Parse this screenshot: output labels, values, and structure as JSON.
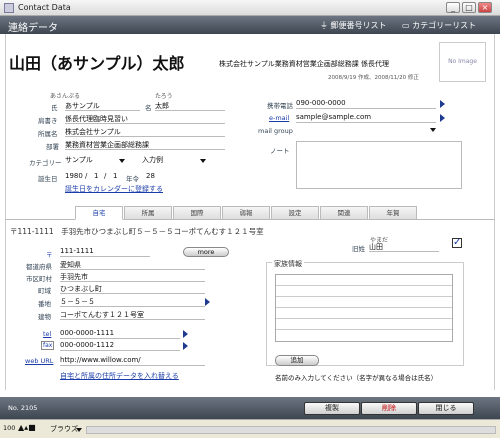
{
  "window": {
    "title": "Contact Data"
  },
  "header": {
    "title": "連絡データ",
    "link_postal": "郵便番号リスト",
    "link_category": "カテゴリーリスト"
  },
  "contact": {
    "name": "山田（あサンプル）太郎",
    "company_title": "株式会社サンプル業務資材営業企画部総務課 係長代理",
    "dates": "2008/9/19 作成、2008/11/20 修正",
    "no_image": "No Image",
    "kana_label": "ふりがな",
    "kana_sei": "あさんぷる",
    "kana_mei": "たろう",
    "sei_label": "氏",
    "sei": "あサンプル",
    "mei_label": "名",
    "mei": "太郎",
    "title_label": "肩書き",
    "title": "係長代理臨時見習い",
    "company_label": "所属名",
    "company": "株式会社サンプル",
    "dept_label": "部署",
    "dept": "業務資材営業企画部総務課",
    "category_label": "カテゴリー",
    "category": "サンプル",
    "category2": "入力例",
    "birthday_label": "誕生日",
    "birth_year": "1980",
    "birth_month": "1",
    "birth_day": "1",
    "age_label": "年令",
    "age": "28",
    "birthday_link": "誕生日をカレンダーに登録する"
  },
  "right": {
    "mobile_label": "携帯電話",
    "mobile": "090-000-0000",
    "email_label": "e-mail",
    "email": "sample@sample.com",
    "mailgroup_label": "mail group",
    "note_label": "ノート"
  },
  "tabs": [
    "自宅",
    "所属",
    "国際",
    "弱報",
    "設定",
    "関連",
    "年賀"
  ],
  "home": {
    "address_header": "〒111-1111　手羽先市ひつまぶし町５－５－５コーポてんむす１２１号室",
    "yashi_label": "やまだ",
    "kyusei_label": "旧姓",
    "kyusei": "山田",
    "postal_label": "〒",
    "postal": "111-1111",
    "more_label": "more",
    "pref_label": "都道府県",
    "pref": "愛知県",
    "city_label": "市区町村",
    "city": "手羽先市",
    "town_label": "町域",
    "town": "ひつまぶし町",
    "banchi_label": "番地",
    "banchi": "５－５－５",
    "building_label": "建物",
    "building": "コーポてんむす１２１号室",
    "tel_label": "tel",
    "tel": "000-0000-1111",
    "fax_label": "fax",
    "fax": "000-0000-1112",
    "web_label": "web URL",
    "web": "http://www.willow.com/",
    "swap_link": "自宅と所属の住所データを入れ替える",
    "family_title": "家族情報",
    "add_label": "追加",
    "family_note": "名前のみ入力してください（名字が異なる場合は氏名）"
  },
  "footer": {
    "record_no": "No. 2105",
    "dup": "複製",
    "delete": "削除",
    "close": "閉じる"
  },
  "status": {
    "zoom": "100",
    "mode": "ブラウズ"
  },
  "colors": {
    "header_bg": "#4a535e",
    "link_blue": "#1a3ca8",
    "delete_red": "#c00000"
  }
}
